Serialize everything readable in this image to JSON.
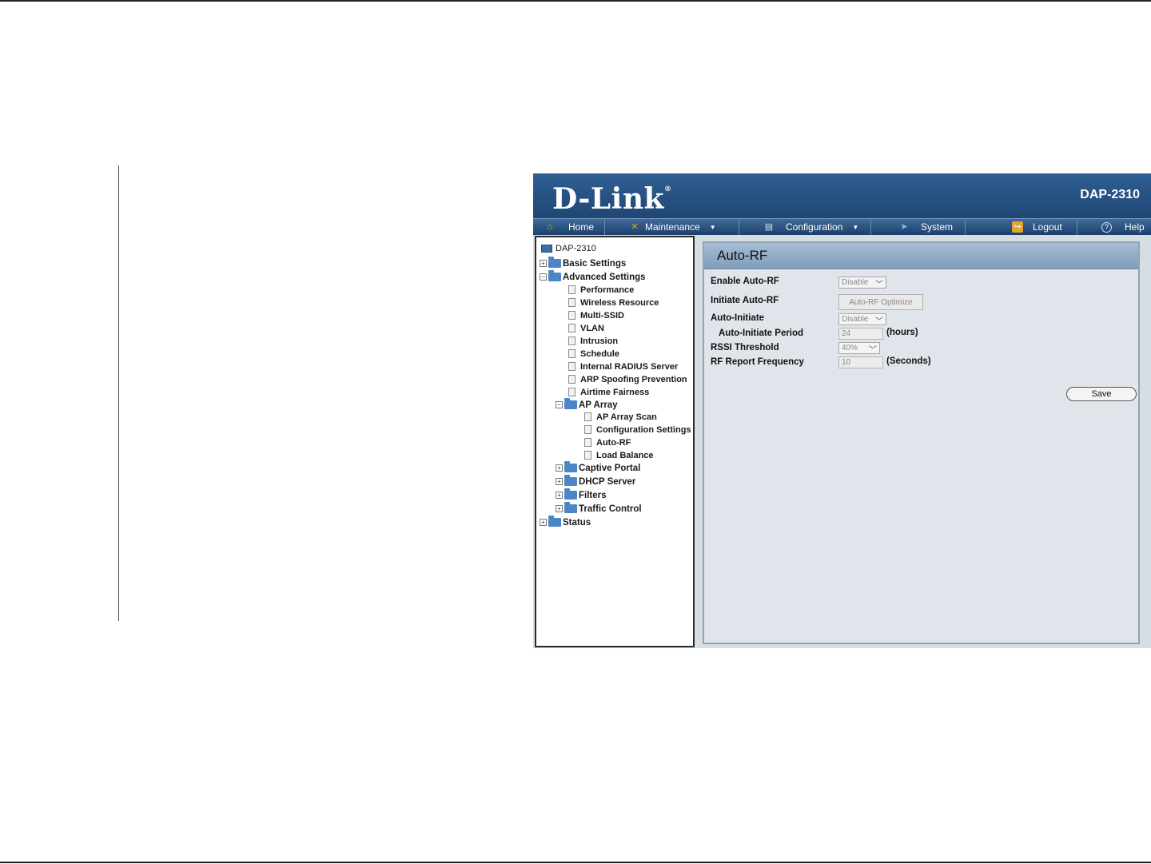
{
  "header": {
    "logo": "D-Link",
    "logo_mark": "®",
    "model": "DAP-2310"
  },
  "menu": {
    "home": "Home",
    "maintenance": "Maintenance",
    "configuration": "Configuration",
    "system": "System",
    "logout": "Logout",
    "help": "Help"
  },
  "tree": {
    "root": "DAP-2310",
    "basic": "Basic Settings",
    "advanced": "Advanced Settings",
    "performance": "Performance",
    "wireless_resource": "Wireless Resource",
    "multi_ssid": "Multi-SSID",
    "vlan": "VLAN",
    "intrusion": "Intrusion",
    "schedule": "Schedule",
    "radius": "Internal RADIUS Server",
    "arp": "ARP Spoofing Prevention",
    "airtime": "Airtime Fairness",
    "ap_array": "AP Array",
    "ap_array_scan": "AP Array Scan",
    "config_settings": "Configuration Settings",
    "auto_rf": "Auto-RF",
    "load_balance": "Load Balance",
    "captive": "Captive Portal",
    "dhcp": "DHCP Server",
    "filters": "Filters",
    "traffic": "Traffic Control",
    "status": "Status"
  },
  "panel": {
    "title": "Auto-RF",
    "enable_label": "Enable Auto-RF",
    "enable_value": "Disable",
    "initiate_label": "Initiate Auto-RF",
    "initiate_button": "Auto-RF Optimize",
    "auto_initiate_label": "Auto-Initiate",
    "auto_initiate_value": "Disable",
    "period_label": "Auto-Initiate Period",
    "period_value": "24",
    "period_unit": "(hours)",
    "rssi_label": "RSSI Threshold",
    "rssi_value": "40%",
    "freq_label": "RF Report Frequency",
    "freq_value": "10",
    "freq_unit": "(Seconds)",
    "save": "Save"
  }
}
